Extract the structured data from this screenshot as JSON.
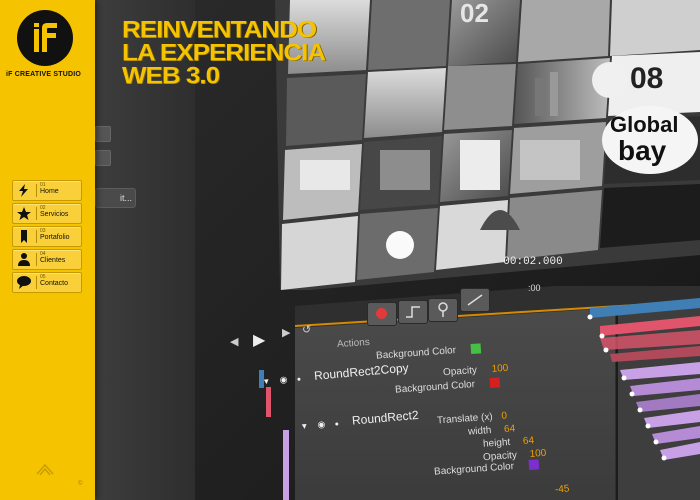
{
  "brand": {
    "logo_text": "iF CREATIVE STUDIO",
    "accent_color": "#f6c300"
  },
  "nav": {
    "items": [
      {
        "num": "01",
        "label": "Home",
        "icon": "lightning-icon"
      },
      {
        "num": "02",
        "label": "Servicios",
        "icon": "star-icon"
      },
      {
        "num": "03",
        "label": "Portafolio",
        "icon": "bookmark-icon"
      },
      {
        "num": "04",
        "label": "Clientes",
        "icon": "person-icon"
      },
      {
        "num": "05",
        "label": "Contacto",
        "icon": "speech-bubble-icon"
      }
    ]
  },
  "footer": {
    "credit": "",
    "copy": "©"
  },
  "headline": {
    "line1": "REINVENTANDO",
    "line2": "LA EXPERIENCIA",
    "line3": "WEB 3.0"
  },
  "editor": {
    "edit_button": "it...",
    "timecode": "00:02.000",
    "ruler_start": ":00",
    "actions_label": "Actions",
    "rows": [
      {
        "name": "Background Color",
        "swatch": "#44c044"
      },
      {
        "name": "RoundRect2Copy",
        "group": true
      },
      {
        "name": "Opacity",
        "value": "100"
      },
      {
        "name": "Background Color",
        "swatch": "#d42020"
      },
      {
        "name": "RoundRect2",
        "group": true
      },
      {
        "name": "Translate (x)",
        "value": "0"
      },
      {
        "name": "width",
        "value": "64"
      },
      {
        "name": "height",
        "value": "64"
      },
      {
        "name": "Opacity",
        "value": "100"
      },
      {
        "name": "Background Color",
        "swatch": "#7b2fcf"
      },
      {
        "name": "",
        "value": "-45"
      }
    ],
    "track_colors": [
      "#3f7fb5",
      "#e0556b",
      "#c8a0e6"
    ]
  },
  "collage": {
    "labels": [
      "02",
      "08",
      "Global",
      "bay"
    ]
  }
}
